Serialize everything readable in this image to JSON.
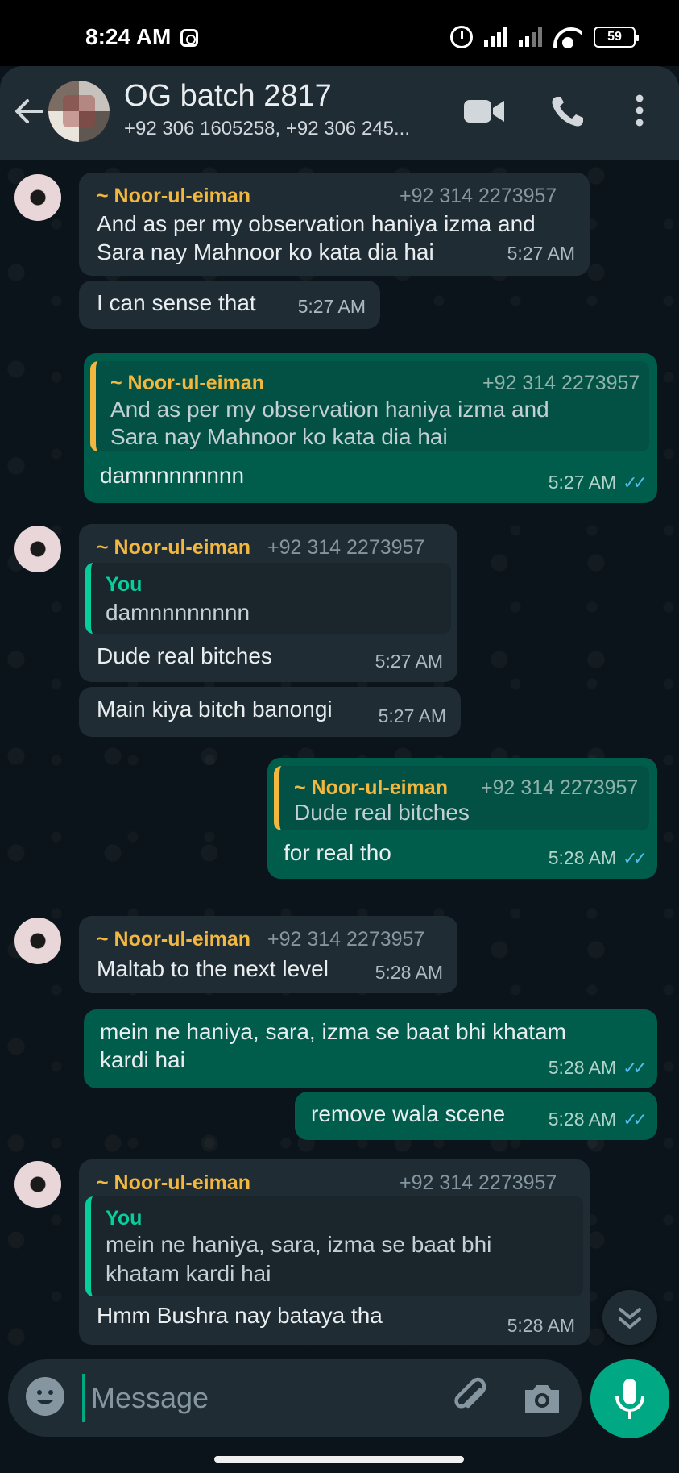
{
  "status_bar": {
    "time": "8:24 AM",
    "battery": "59",
    "icons": [
      "instagram-icon",
      "alarm-icon",
      "signal-icon",
      "wifi-icon",
      "battery-icon"
    ]
  },
  "header": {
    "title": "OG batch 2817",
    "subtitle": "+92 306 1605258, +92 306 245...",
    "icons": [
      "back-arrow-icon",
      "video-call-icon",
      "voice-call-icon",
      "more-options-icon"
    ]
  },
  "messages": [
    {
      "direction": "incoming",
      "sender": "~ Noor-ul-eiman",
      "phone": "+92 314 2273957",
      "line1": "And as per my observation haniya izma and",
      "line2": "Sara nay Mahnoor ko kata dia hai",
      "time": "5:27 AM"
    },
    {
      "direction": "incoming",
      "text": "I can sense that",
      "time": "5:27 AM"
    },
    {
      "direction": "outgoing",
      "quote_sender": "~ Noor-ul-eiman",
      "quote_phone": "+92 314 2273957",
      "quote_line1": "And as per my observation haniya izma and",
      "quote_line2": "Sara nay Mahnoor ko kata dia hai",
      "text": "damnnnnnnnn",
      "time": "5:27 AM",
      "read": true
    },
    {
      "direction": "incoming",
      "sender": "~ Noor-ul-eiman",
      "phone": "+92 314 2273957",
      "quote_sender": "You",
      "quote_text": "damnnnnnnnn",
      "text": "Dude real bitches",
      "time": "5:27 AM"
    },
    {
      "direction": "incoming",
      "text": "Main kiya bitch banongi",
      "time": "5:27 AM"
    },
    {
      "direction": "outgoing",
      "quote_sender": "~ Noor-ul-eiman",
      "quote_phone": "+92 314 2273957",
      "quote_text": "Dude real bitches",
      "text": "for real tho",
      "time": "5:28 AM",
      "read": true
    },
    {
      "direction": "incoming",
      "sender": "~ Noor-ul-eiman",
      "phone": "+92 314 2273957",
      "text": "Maltab to the next level",
      "time": "5:28 AM"
    },
    {
      "direction": "outgoing",
      "line1": "mein ne haniya, sara, izma se baat bhi khatam",
      "line2": "kardi hai",
      "time": "5:28 AM",
      "read": true
    },
    {
      "direction": "outgoing",
      "text": "remove wala scene",
      "time": "5:28 AM",
      "read": true
    },
    {
      "direction": "incoming",
      "sender": "~ Noor-ul-eiman",
      "phone": "+92 314 2273957",
      "quote_sender": "You",
      "quote_line1": "mein ne haniya, sara, izma se baat bhi",
      "quote_line2": "khatam kardi hai",
      "text": "Hmm Bushra nay bataya tha",
      "time": "5:28 AM"
    }
  ],
  "composer": {
    "placeholder": "Message",
    "icons": [
      "emoji-icon",
      "attach-icon",
      "camera-icon",
      "mic-icon"
    ]
  },
  "colors": {
    "incoming_bubble": "#1f2c34",
    "outgoing_bubble": "#005c4b",
    "sender_name": "#f2b73e",
    "you_quote": "#06cf9c",
    "read_ticks": "#53bdeb",
    "accent": "#00a884"
  }
}
